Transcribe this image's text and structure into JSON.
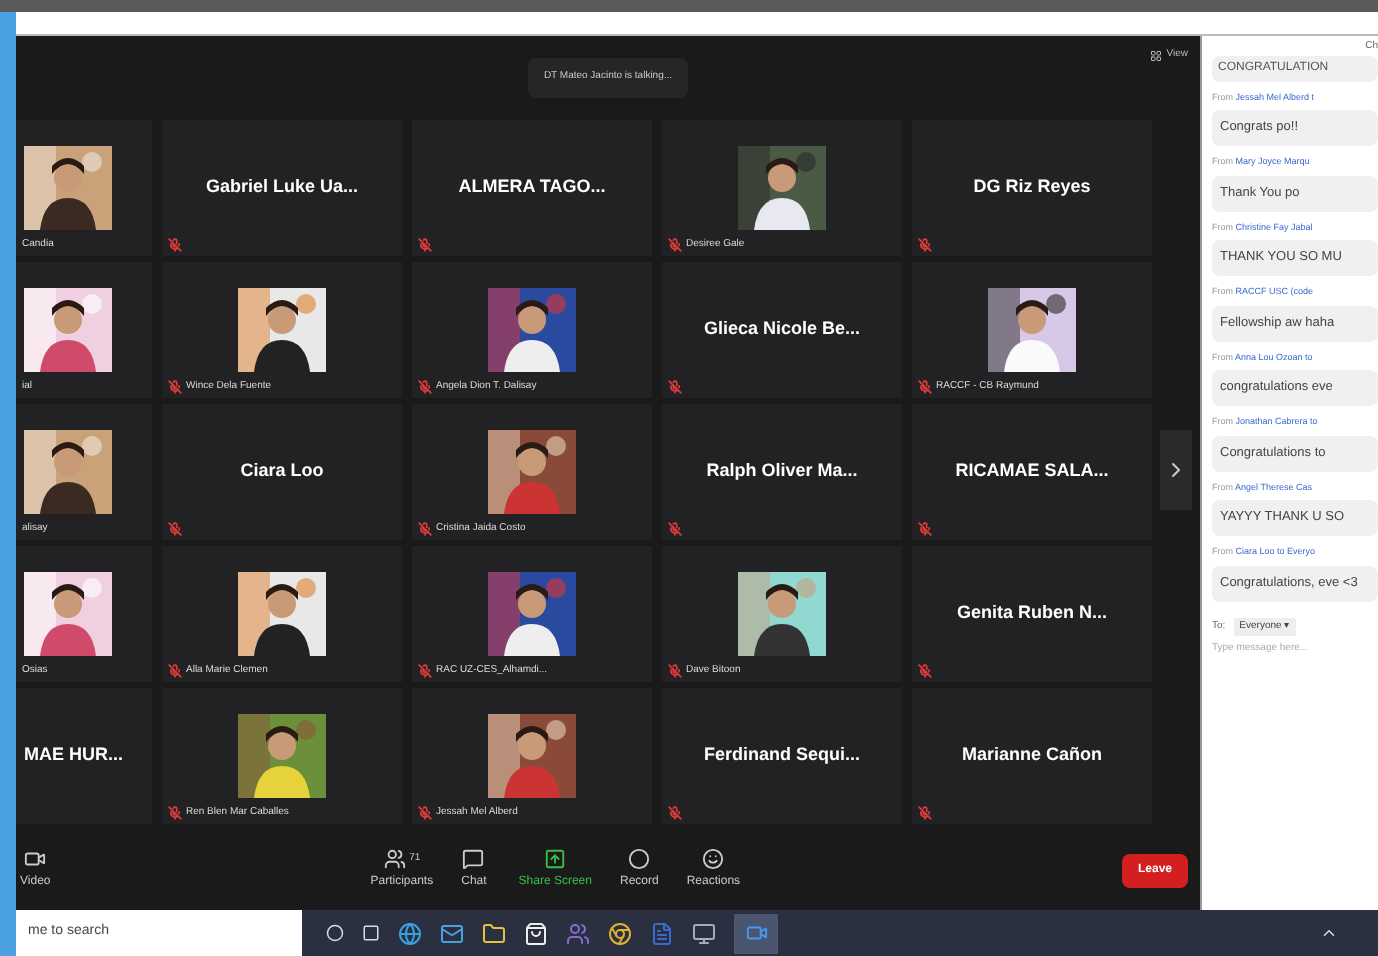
{
  "talking": "DT Mateo Jacinto is talking...",
  "view": "View",
  "tiles": [
    {
      "kind": "picture",
      "name": "Candia"
    },
    {
      "kind": "name",
      "name": "Gabriel Luke Ua..."
    },
    {
      "kind": "name",
      "name": "ALMERA  TAGO..."
    },
    {
      "kind": "picture",
      "name": "Desiree Gale"
    },
    {
      "kind": "name",
      "name": "DG Riz Reyes"
    },
    {
      "kind": "picture",
      "name": "ial"
    },
    {
      "kind": "picture",
      "name": "Wince Dela Fuente"
    },
    {
      "kind": "picture",
      "name": "Angela Dion T. Dalisay"
    },
    {
      "kind": "name",
      "name": "Glieca Nicole Be..."
    },
    {
      "kind": "picture",
      "name": "RACCF - CB Raymund"
    },
    {
      "kind": "picture",
      "name": "alisay"
    },
    {
      "kind": "name",
      "name": "Ciara Loo"
    },
    {
      "kind": "picture",
      "name": "Cristina Jaida Costo"
    },
    {
      "kind": "name",
      "name": "Ralph Oliver Ma..."
    },
    {
      "kind": "name",
      "name": "RICAMAE  SALA..."
    },
    {
      "kind": "picture",
      "name": "Osias"
    },
    {
      "kind": "picture",
      "name": "Alla Marie Clemen"
    },
    {
      "kind": "picture",
      "name": "RAC UZ-CES_Alhamdi..."
    },
    {
      "kind": "picture",
      "name": "Dave Bitoon"
    },
    {
      "kind": "name",
      "name": "Genita Ruben N..."
    },
    {
      "kind": "name",
      "name": "MAE HUR..."
    },
    {
      "kind": "picture",
      "name": "Ren Blen Mar Caballes"
    },
    {
      "kind": "picture",
      "name": "Jessah Mel Alberd"
    },
    {
      "kind": "name",
      "name": "Ferdinand Sequi..."
    },
    {
      "kind": "name",
      "name": "Marianne Cañon"
    }
  ],
  "chat": {
    "title": "Ch",
    "first": "CONGRATULATION",
    "messages": [
      {
        "from": "From",
        "sender": "Jessah Mel Alberd t",
        "text": "Congrats po!!"
      },
      {
        "from": "From",
        "sender": "Mary Joyce Marqu",
        "text": "Thank You po"
      },
      {
        "from": "From",
        "sender": "Christine Fay Jabal",
        "text": "THANK YOU SO MU"
      },
      {
        "from": "From",
        "sender": "RACCF USC (code",
        "text": "Fellowship aw haha"
      },
      {
        "from": "From",
        "sender": "Anna Lou Ozoan to",
        "text": "congratulations eve"
      },
      {
        "from": "From",
        "sender": "Jonathan Cabrera to",
        "text": "Congratulations to"
      },
      {
        "from": "From",
        "sender": "Angel Therese Cas",
        "text": "YAYYY THANK U SO"
      },
      {
        "from": "From",
        "sender": "Ciara Loo to Everyo",
        "text": "Congratulations, eve <3"
      }
    ],
    "to": "To:",
    "recipient": "Everyone ▾",
    "placeholder": "Type message here..."
  },
  "toolbar": [
    {
      "label": "Video",
      "kind": "video"
    },
    {
      "label": "Participants",
      "kind": "participants",
      "count": "71"
    },
    {
      "label": "Chat",
      "kind": "chat"
    },
    {
      "label": "Share Screen",
      "kind": "share"
    },
    {
      "label": "Record",
      "kind": "record"
    },
    {
      "label": "Reactions",
      "kind": "reactions"
    }
  ],
  "leave": "Leave",
  "search": "me to search"
}
